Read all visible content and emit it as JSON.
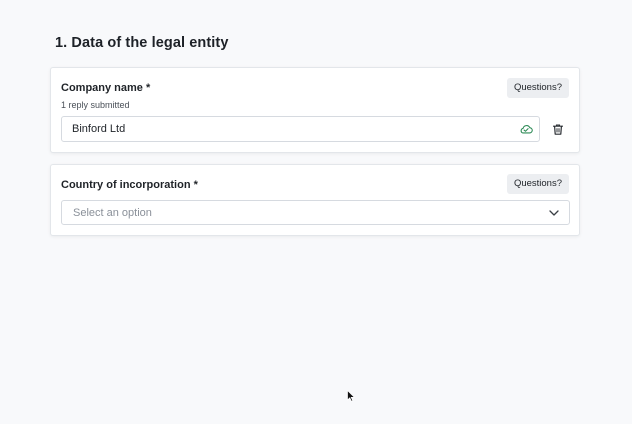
{
  "section": {
    "title": "1. Data of the legal entity"
  },
  "company_name": {
    "label": "Company name *",
    "status": "1 reply submitted",
    "value": "Binford Ltd",
    "questions_label": "Questions?",
    "save_icon": "cloud-check-icon",
    "delete_icon": "trash-icon",
    "save_icon_color": "#2e8b57"
  },
  "country": {
    "label": "Country of incorporation *",
    "placeholder": "Select an option",
    "questions_label": "Questions?",
    "dropdown_icon": "chevron-down-icon"
  }
}
